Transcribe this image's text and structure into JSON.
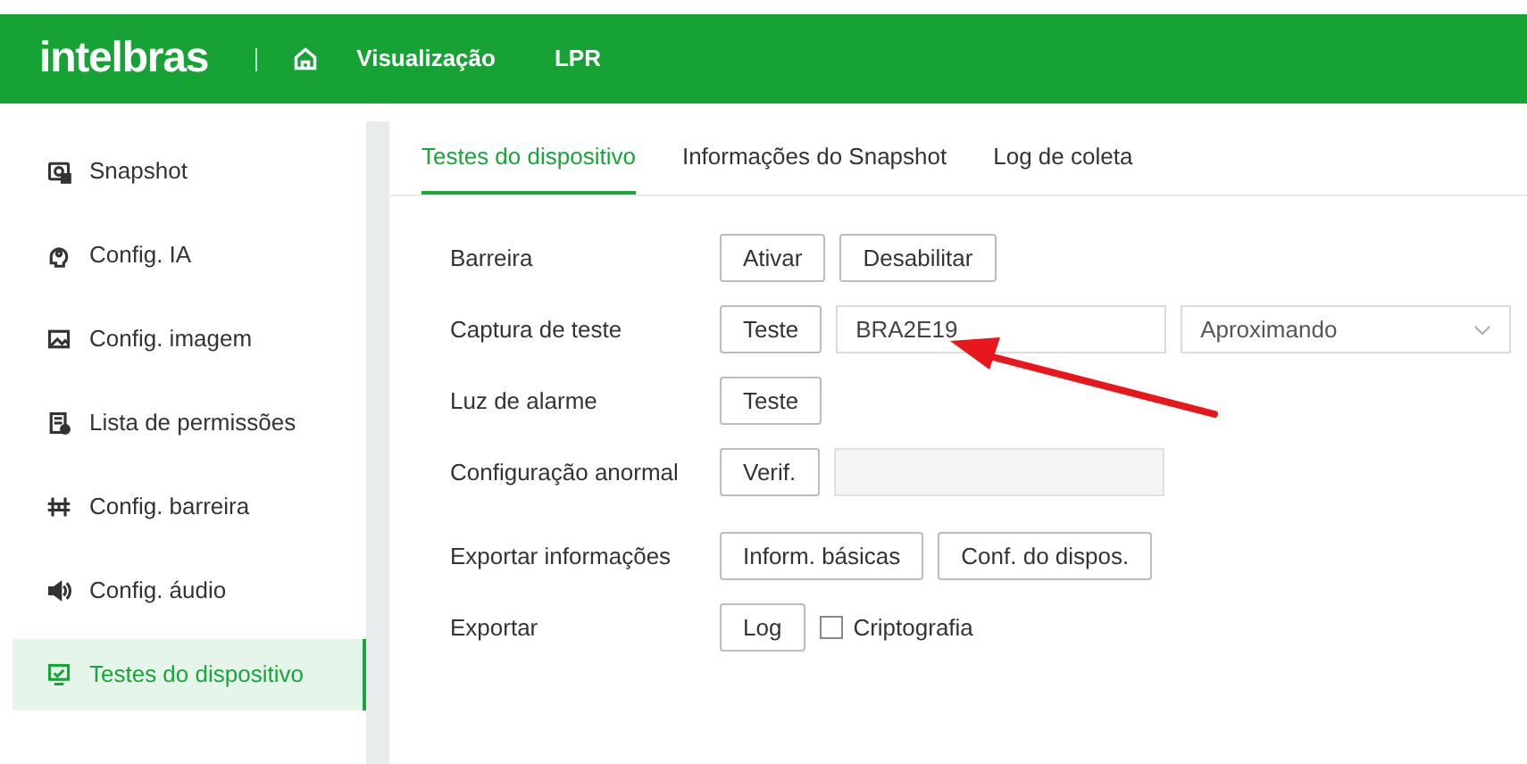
{
  "header": {
    "logo": "intelbras",
    "nav": [
      {
        "label": "Visualização",
        "selected": false
      },
      {
        "label": "LPR",
        "selected": false
      }
    ]
  },
  "sidebar": {
    "items": [
      {
        "label": "Snapshot",
        "kind": "snapshot",
        "selected": false
      },
      {
        "label": "Config. IA",
        "kind": "ai",
        "selected": false
      },
      {
        "label": "Config. imagem",
        "kind": "image",
        "selected": false
      },
      {
        "label": "Lista de permissões",
        "kind": "list",
        "selected": false
      },
      {
        "label": "Config. barreira",
        "kind": "barrier",
        "selected": false
      },
      {
        "label": "Config. áudio",
        "kind": "audio",
        "selected": false
      },
      {
        "label": "Testes do dispositivo",
        "kind": "monitor",
        "selected": true
      }
    ]
  },
  "tabs": [
    {
      "label": "Testes do dispositivo",
      "selected": true
    },
    {
      "label": "Informações do Snapshot",
      "selected": false
    },
    {
      "label": "Log de coleta",
      "selected": false
    }
  ],
  "rows": [
    {
      "label": "Barreira",
      "controls": [
        {
          "kind": "button",
          "label": "Ativar"
        },
        {
          "kind": "button",
          "label": "Desabilitar"
        }
      ]
    },
    {
      "label": "Captura de teste",
      "controls": [
        {
          "kind": "button",
          "label": "Teste"
        },
        {
          "kind": "input",
          "value": "BRA2E19"
        },
        {
          "kind": "select",
          "value": "Aproximando"
        }
      ]
    },
    {
      "label": "Luz de alarme",
      "controls": [
        {
          "kind": "button",
          "label": "Teste"
        }
      ]
    },
    {
      "label": "Configuração anormal",
      "controls": [
        {
          "kind": "button",
          "label": "Verif."
        },
        {
          "kind": "readonly"
        }
      ]
    },
    {
      "label": "Exportar informações",
      "controls": [
        {
          "kind": "button",
          "label": "Inform. básicas"
        },
        {
          "kind": "button",
          "label": "Conf. do dispos."
        }
      ]
    },
    {
      "label": "Exportar",
      "controls": [
        {
          "kind": "button",
          "label": "Log"
        },
        {
          "kind": "checkbox",
          "label": "Criptografia",
          "checked": false
        }
      ]
    }
  ]
}
